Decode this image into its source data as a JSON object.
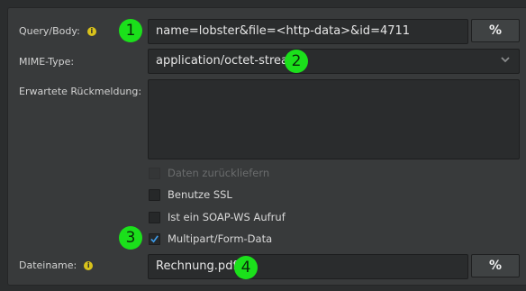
{
  "form": {
    "query_label": "Query/Body:",
    "query_value": "name=lobster&file=<http-data>&id=4711",
    "query_button": "%",
    "mime_label": "MIME-Type:",
    "mime_value": "application/octet-stream",
    "response_label": "Erwartete Rückmeldung:",
    "response_value": "",
    "checkboxes": [
      {
        "label": "Daten zurückliefern",
        "checked": false,
        "disabled": true
      },
      {
        "label": "Benutze SSL",
        "checked": false,
        "disabled": false
      },
      {
        "label": "Ist ein SOAP-WS Aufruf",
        "checked": false,
        "disabled": false
      },
      {
        "label": "Multipart/Form-Data",
        "checked": true,
        "disabled": false
      }
    ],
    "filename_label": "Dateiname:",
    "filename_value": "Rechnung.pdf",
    "filename_button": "%"
  },
  "annotations": [
    "1",
    "2",
    "3",
    "4"
  ],
  "icons": {
    "info": "info-icon",
    "dropdown": "chevron-down-icon",
    "check": "check-icon"
  },
  "colors": {
    "badge": "#1be01b",
    "info": "#d9c21b",
    "check": "#3d9be9"
  }
}
